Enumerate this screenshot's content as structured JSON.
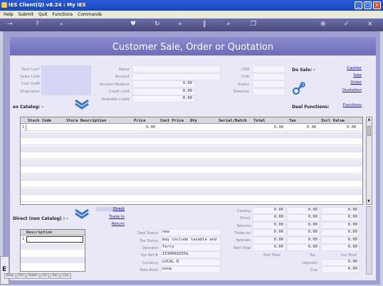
{
  "window": {
    "title": "IES Client(Q) v8.24 : My IES"
  },
  "menu": [
    "Help",
    "Submit",
    "Quit",
    "Functions",
    "Commands"
  ],
  "header": {
    "title": "Customer Sale, Order or Quotation"
  },
  "customer": {
    "labels": [
      "Find Cust?",
      "Sales Code",
      "Cust Ord#",
      "Origination"
    ],
    "name_labels": [
      "Name",
      "Account",
      "Account Balance",
      "Credit Limit",
      "Available Credit"
    ],
    "balance": "0.00",
    "credit_limit": "0.00",
    "available": "0.00",
    "crm_labels": [
      "CRM",
      "Club",
      "Expiry",
      "Directive"
    ]
  },
  "do_sale": {
    "label": "Do Sale: -",
    "links": [
      "Cashier",
      "Sale",
      "Order",
      "Quotation"
    ]
  },
  "catalog": {
    "label": "ex Catalog: -"
  },
  "deal_functions": {
    "label": "Deal Functions:",
    "link": "Functions"
  },
  "grid": {
    "columns": [
      "Stock Code",
      "Store Description",
      "Price",
      "Cust Price",
      "Qty",
      "Serial/Batch",
      "Total",
      "Tax",
      "Incl Value"
    ],
    "row1": {
      "num": "1",
      "price": "0.00",
      "total": "0.00",
      "tax": "0.00",
      "incl": "0.00"
    }
  },
  "direct": {
    "label": "Direct (non Catalog) : -",
    "links": [
      "Direct",
      "Trade In",
      "Return"
    ],
    "grid_header": "Description",
    "row_num": "1"
  },
  "deal": {
    "labels": [
      "Deal Status",
      "Tax Status",
      "Operator",
      "Sys Ref #",
      "Currency",
      "Rate Book"
    ],
    "values": [
      "new",
      "may include taxable and",
      "Terry",
      "1534669255&",
      "LOCAL R",
      "none"
    ]
  },
  "totals": {
    "labels": [
      "Catalog",
      "Direct",
      "Returns",
      "Trade-Ins",
      "Specials",
      "Nett Total"
    ],
    "values": [
      "0.00",
      "0.00",
      "0.00",
      "0.00",
      "0.00",
      "0.00"
    ],
    "col_labels": [
      "Excl Total",
      "Tax",
      "Incl Total"
    ],
    "deposits_label": "Deposits",
    "due_label": "Due",
    "deposits": "0.00",
    "due": "0.00"
  },
  "bottom_tabs": [
    "New",
    "Pre",
    "Subm",
    "Ins",
    "Del",
    "Can"
  ],
  "icons": [
    "key-icon",
    "help-icon",
    "search-icon",
    "heart-icon",
    "refresh-icon",
    "rewind-icon",
    "pause-icon",
    "forward-icon",
    "copy-icon",
    "add-icon",
    "check-icon",
    "close-icon"
  ]
}
